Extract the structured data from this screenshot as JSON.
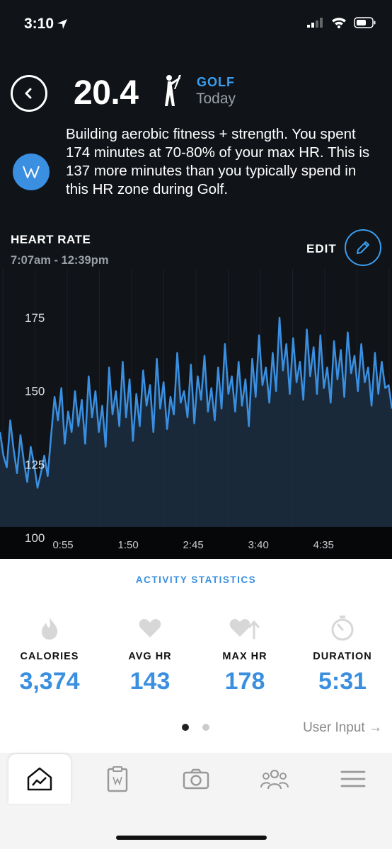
{
  "status_bar": {
    "time": "3:10"
  },
  "header": {
    "strain": "20.4",
    "sport": "GOLF",
    "day": "Today"
  },
  "insight": {
    "text": "Building aerobic fitness + strength. You spent 174 minutes at 70-80% of your max HR. This is 137 more minutes than you typically spend in this HR zone during Golf."
  },
  "heart_rate": {
    "title": "HEART RATE",
    "time_range": "7:07am - 12:39pm",
    "edit_label": "EDIT"
  },
  "chart_data": {
    "type": "area",
    "title": "HEART RATE",
    "ylim": [
      100,
      180
    ],
    "yticks": [
      100,
      125,
      150,
      175
    ],
    "xticks": [
      "0:55",
      "1:50",
      "2:45",
      "3:40",
      "4:35"
    ],
    "xlim_minutes": [
      0,
      331
    ],
    "tick_minutes": [
      55,
      110,
      165,
      220,
      275
    ],
    "color": "#3a8fe0",
    "series": [
      {
        "values": [
          136,
          128,
          124,
          140,
          130,
          122,
          135,
          126,
          119,
          131,
          125,
          117,
          122,
          128,
          121,
          135,
          148,
          140,
          151,
          132,
          143,
          136,
          150,
          138,
          147,
          132,
          155,
          141,
          150,
          136,
          145,
          131,
          158,
          142,
          150,
          138,
          160,
          141,
          154,
          133,
          149,
          138,
          157,
          145,
          152,
          136,
          161,
          144,
          153,
          137,
          148,
          142,
          163,
          146,
          150,
          141,
          159,
          139,
          155,
          147,
          162,
          143,
          151,
          140,
          158,
          144,
          166,
          149,
          155,
          143,
          160,
          145,
          154,
          138,
          161,
          148,
          169,
          152,
          158,
          146,
          163,
          150,
          175,
          157,
          166,
          149,
          168,
          153,
          160,
          147,
          171,
          155,
          165,
          149,
          169,
          151,
          158,
          146,
          167,
          154,
          164,
          148,
          170,
          156,
          162,
          150,
          166,
          153,
          158,
          145,
          163,
          149,
          160,
          151,
          152,
          144
        ]
      }
    ]
  },
  "stats": {
    "section_title": "ACTIVITY STATISTICS",
    "items": [
      {
        "label": "CALORIES",
        "value": "3,374"
      },
      {
        "label": "AVG HR",
        "value": "143"
      },
      {
        "label": "MAX HR",
        "value": "178"
      },
      {
        "label": "DURATION",
        "value": "5:31"
      }
    ],
    "link_label": "User Input →"
  },
  "tabs": [
    "home",
    "journal",
    "camera",
    "community",
    "menu"
  ]
}
